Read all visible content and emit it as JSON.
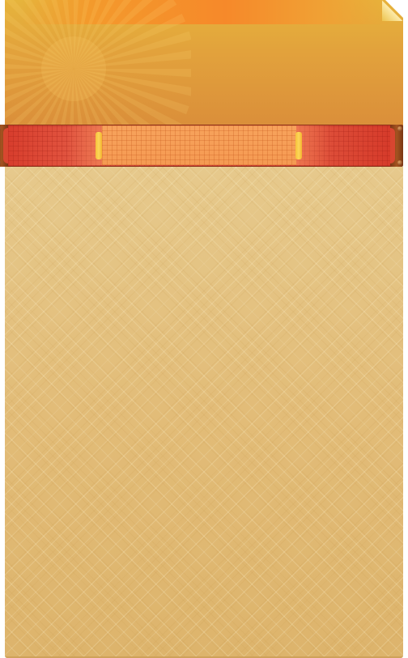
{
  "theme": {
    "header_color": "#e2a23c",
    "glow_color": "#f6892a",
    "ribbon_color": "#e0503c",
    "ribbon_center_color": "#f7a35c",
    "clip_color": "#fcd75a",
    "cap_color": "#8a4418",
    "body_color": "#e2bc78"
  },
  "icons": {
    "sunburst": "sunburst-icon",
    "corner": "page-fold-icon"
  }
}
